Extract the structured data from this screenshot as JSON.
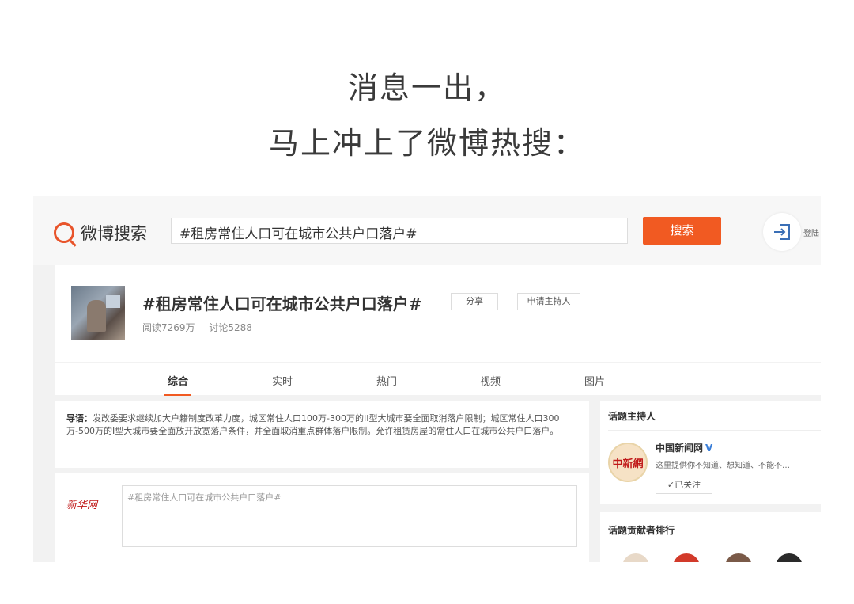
{
  "caption": {
    "line1": "消息一出，",
    "line2": "马上冲上了微博热搜："
  },
  "topbar": {
    "logo_text": "微博搜索",
    "search_value": "#租房常住人口可在城市公共户口落户#",
    "search_button": "搜索",
    "login_label": "登陆",
    "accent": "#f15a22"
  },
  "topic": {
    "title": "#租房常住人口可在城市公共户口落户#",
    "reads": "阅读7269万",
    "discussions": "讨论5288",
    "share_button": "分享",
    "apply_host_button": "申请主持人"
  },
  "tabs": [
    {
      "label": "综合",
      "active": true
    },
    {
      "label": "实时",
      "active": false
    },
    {
      "label": "热门",
      "active": false
    },
    {
      "label": "视频",
      "active": false
    },
    {
      "label": "图片",
      "active": false
    }
  ],
  "lead": {
    "label": "导语：",
    "text": "发改委要求继续加大户籍制度改革力度，城区常住人口100万-300万的II型大城市要全面取消落户限制；城区常住人口300万-500万的I型大城市要全面放开放宽落户条件，并全面取消重点群体落户限制。允许租赁房屋的常住人口在城市公共户口落户。"
  },
  "composer": {
    "logo_text": "新华网",
    "placeholder": "#租房常住人口可在城市公共户口落户#"
  },
  "sidebar": {
    "host_title": "话题主持人",
    "host_name": "中国新闻网",
    "host_avatar_text": "中新網",
    "host_desc": "这里提供你不知道、想知道、不能不…",
    "follow_button": "✓已关注",
    "contributors_title": "话题贡献者排行"
  }
}
